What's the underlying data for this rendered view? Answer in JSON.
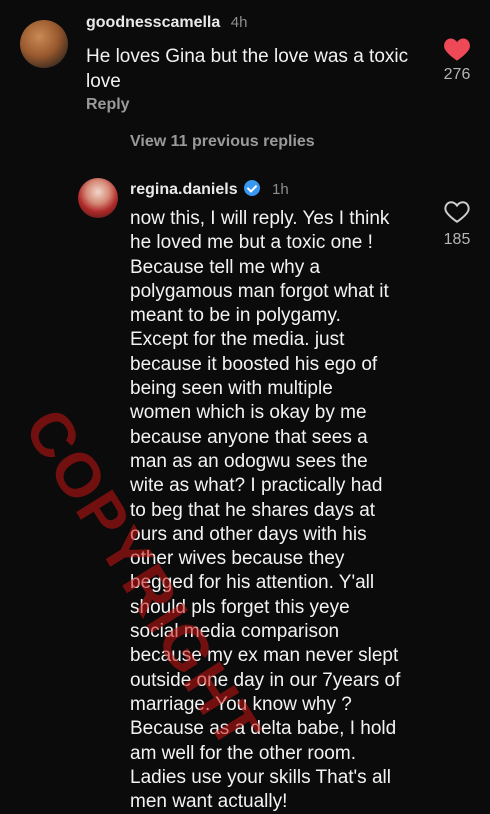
{
  "comments": [
    {
      "username": "goodnesscamella",
      "time": "4h",
      "text": "He loves Gina but the love was a toxic love",
      "likes": "276",
      "liked": true,
      "reply_label": "Reply"
    },
    {
      "username": "regina.daniels",
      "time": "1h",
      "verified": true,
      "text": "now this, I will reply. Yes I think\nhe loved me but a toxic one !\nBecause tell me why a\npolygamous man forgot what it\nmeant to be in polygamy.\nExcept for the media. just\nbecause it boosted his ego of\nbeing seen with multiple\nwomen which is okay by me\nbecause anyone that sees a\nman as an odogwu sees the\nwite as what? I practically had\nto beg that he shares days at\nours and other days with his\nother wives because they\nbegged for his attention. Y'all\nshould pls forget this yeye\nsocial media comparison\nbecause my ex man never slept\noutside one day in our 7years of\nmarriage. You know why ?\nBecause as a delta babe, I hold\nam well for the other room.\nLadies use your skills That's all\nmen want actually!",
      "likes": "185",
      "liked": false
    }
  ],
  "view_previous_label": "View 11 previous replies",
  "watermark": "COPYRIGHT",
  "colors": {
    "like_red": "#ed4956",
    "verified_blue": "#3897f0"
  }
}
